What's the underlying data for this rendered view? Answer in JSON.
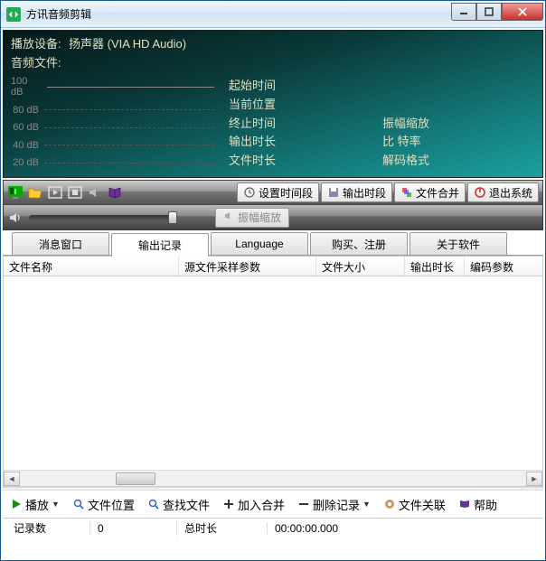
{
  "window": {
    "title": "方讯音频剪辑"
  },
  "info": {
    "device_label": "播放设备:",
    "device_value": "扬声器 (VIA HD Audio)",
    "file_label": "音频文件:",
    "db_labels": [
      "100 dB",
      "80 dB",
      "60 dB",
      "40 dB",
      "20 dB"
    ],
    "times": {
      "start": "起始时间",
      "current": "当前位置",
      "end": "终止时间",
      "out_dur": "输出时长",
      "file_dur": "文件时长",
      "amp_scale": "振幅缩放",
      "bitrate": "比 特率",
      "decode_fmt": "解码格式"
    }
  },
  "toolbar": {
    "set_period": "设置时间段",
    "out_period": "输出时段",
    "merge": "文件合并",
    "exit": "退出系统",
    "amp_btn": "振幅缩放"
  },
  "tabs": {
    "msg": "消息窗口",
    "out": "输出记录",
    "lang": "Language",
    "buy": "购买、注册",
    "about": "关于软件"
  },
  "table": {
    "c1": "文件名称",
    "c2": "源文件采样参数",
    "c3": "文件大小",
    "c4": "输出时长",
    "c5": "编码参数"
  },
  "bottom": {
    "play": "播放",
    "file_loc": "文件位置",
    "find": "查找文件",
    "add_merge": "加入合并",
    "del_rec": "删除记录",
    "assoc": "文件关联",
    "help": "帮助"
  },
  "status": {
    "rec_label": "记录数",
    "rec_val": "0",
    "dur_label": "总时长",
    "dur_val": "00:00:00.000"
  },
  "colors": {
    "accent": "#147a7a"
  }
}
